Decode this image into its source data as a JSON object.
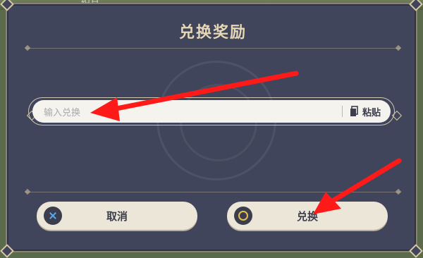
{
  "background": {
    "partial_text": "织月"
  },
  "dialog": {
    "title": "兑换奖励",
    "input": {
      "placeholder": "输入兑换"
    },
    "paste_label": "粘贴",
    "cancel_label": "取消",
    "confirm_label": "兑换"
  },
  "colors": {
    "panel": "#41455b",
    "accent": "#e7d8b5",
    "button": "#ece6d8",
    "arrow": "#ff1a1a",
    "cancel_icon": "#5aa6e6",
    "confirm_icon": "#e5be4e"
  },
  "annotations": {
    "arrows": [
      "arrow-to-input",
      "arrow-to-confirm"
    ]
  }
}
